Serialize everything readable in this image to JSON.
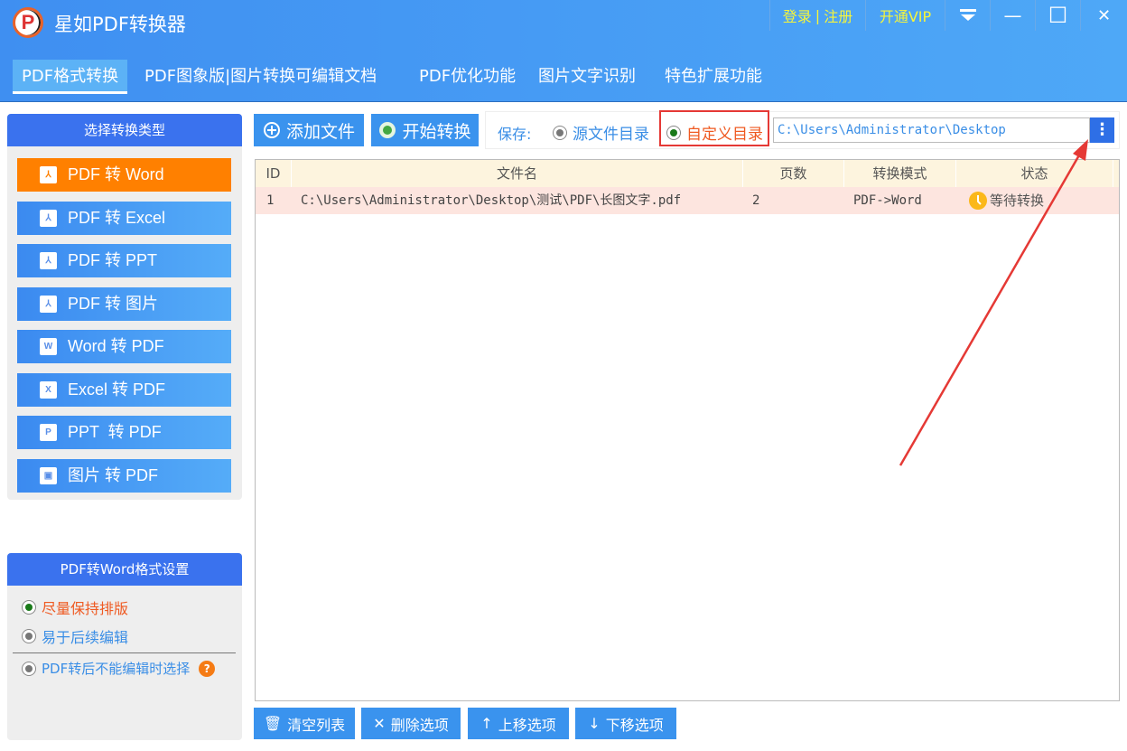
{
  "app": {
    "title": "星如PDF转换器",
    "logo": "P"
  },
  "window": {
    "login": "登录",
    "sep": "|",
    "register": "注册",
    "vip": "开通VIP",
    "menu_icon": "dropdown-icon",
    "min": "—",
    "max": "☐",
    "close": "✕"
  },
  "tabs": [
    "PDF格式转换",
    "PDF图象版|图片转换可编辑文档",
    "PDF优化功能",
    "图片文字识别",
    "特色扩展功能"
  ],
  "left": {
    "header": "选择转换类型",
    "items": [
      {
        "label": "PDF 转 Word",
        "icon": "⅄"
      },
      {
        "label": "PDF 转 Excel",
        "icon": "⅄"
      },
      {
        "label": "PDF 转 PPT",
        "icon": "⅄"
      },
      {
        "label": "PDF 转 图片",
        "icon": "⅄"
      },
      {
        "label": "Word 转 PDF",
        "icon": "W"
      },
      {
        "label": "Excel 转 PDF",
        "icon": "X"
      },
      {
        "label": "PPT  转 PDF",
        "icon": "P"
      },
      {
        "label": "图片 转 PDF",
        "icon": "▣"
      }
    ]
  },
  "settings": {
    "header": "PDF转Word格式设置",
    "options": [
      "尽量保持排版",
      "易于后续编辑",
      "PDF转后不能编辑时选择"
    ],
    "help": "?"
  },
  "toolbar": {
    "add": "添加文件",
    "start": "开始转换",
    "save_label": "保存:",
    "source_dir": "源文件目录",
    "custom_dir": "自定义目录",
    "path": "C:\\Users\\Administrator\\Desktop",
    "more": "⋮"
  },
  "table": {
    "headers": [
      "ID",
      "文件名",
      "页数",
      "转换模式",
      "状态"
    ],
    "rows": [
      {
        "id": "1",
        "file": "C:\\Users\\Administrator\\Desktop\\测试\\PDF\\长图文字.pdf",
        "pages": "2",
        "mode": "PDF->Word",
        "status": "等待转换"
      }
    ]
  },
  "bottom": {
    "clear": "清空列表",
    "delete": "删除选项",
    "up": "上移选项",
    "down": "下移选项"
  },
  "colors": {
    "accent": "#3a93ee",
    "active": "#ff8000",
    "highlight": "#e53935"
  }
}
